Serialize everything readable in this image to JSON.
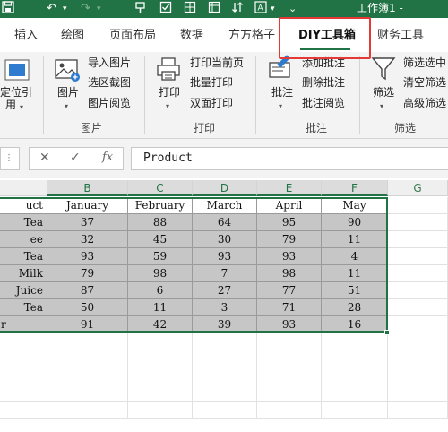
{
  "titlebar": {
    "title": "工作簿1 -"
  },
  "tabs": [
    {
      "label": "插入"
    },
    {
      "label": "绘图"
    },
    {
      "label": "页面布局"
    },
    {
      "label": "数据"
    },
    {
      "label": "方方格子"
    },
    {
      "label": "DIY工具箱"
    },
    {
      "label": "财务工具"
    }
  ],
  "ribbon": {
    "locate": {
      "line1": "定位引",
      "line2": "用"
    },
    "picture_group": {
      "big_label": "图片",
      "items": [
        "导入图片",
        "选区截图",
        "图片阅览"
      ],
      "group_label": "图片"
    },
    "print_group": {
      "big_label": "打印",
      "items": [
        "打印当前页",
        "批量打印",
        "双面打印"
      ],
      "group_label": "打印"
    },
    "comment_group": {
      "big_label": "批注",
      "items": [
        "添加批注",
        "删除批注",
        "批注阅览"
      ],
      "group_label": "批注"
    },
    "filter_group": {
      "big_label": "筛选",
      "items": [
        "筛选选中",
        "清空筛选",
        "高级筛选"
      ],
      "group_label": "筛选"
    }
  },
  "formula_bar": {
    "fx": "fx",
    "value": "Product"
  },
  "columns": [
    "B",
    "C",
    "D",
    "E",
    "F",
    "G"
  ],
  "table": {
    "header_first": "uct",
    "headers": [
      "January",
      "February",
      "March",
      "April",
      "May"
    ],
    "rows": [
      {
        "name": "Tea",
        "values": [
          "37",
          "88",
          "64",
          "95",
          "90"
        ]
      },
      {
        "name": "ee",
        "values": [
          "32",
          "45",
          "30",
          "79",
          "11"
        ]
      },
      {
        "name": "Tea",
        "values": [
          "93",
          "59",
          "93",
          "93",
          "4"
        ]
      },
      {
        "name": "Milk",
        "values": [
          "79",
          "98",
          "7",
          "98",
          "11"
        ]
      },
      {
        "name": "Juice",
        "values": [
          "87",
          "6",
          "27",
          "77",
          "51"
        ]
      },
      {
        "name": "Tea",
        "values": [
          "50",
          "11",
          "3",
          "71",
          "28"
        ]
      },
      {
        "name": "r",
        "values": [
          "91",
          "42",
          "39",
          "93",
          "16"
        ]
      }
    ]
  },
  "colors": {
    "excel_green": "#217346",
    "highlight_red": "#e53935",
    "data_fill": "#c6c6c6"
  }
}
